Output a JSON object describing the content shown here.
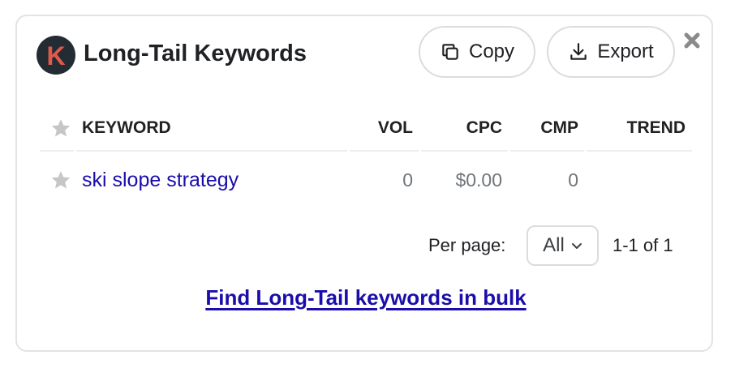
{
  "widget": {
    "title": "Long-Tail Keywords",
    "logo_letter": "K",
    "brand_color": "#e05a4c",
    "copy_label": "Copy",
    "export_label": "Export",
    "icons": {
      "copy": "copy-icon",
      "export": "download-icon",
      "close": "close-icon",
      "star": "star-icon",
      "chevron": "chevron-down-icon"
    }
  },
  "table": {
    "columns": [
      "KEYWORD",
      "VOL",
      "CPC",
      "CMP",
      "TREND"
    ],
    "rows": [
      {
        "keyword": "ski slope strategy",
        "vol": "0",
        "cpc": "$0.00",
        "cmp": "0",
        "trend": ""
      }
    ]
  },
  "pagination": {
    "per_page_label": "Per page:",
    "per_page_value": "All",
    "range_text": "1-1 of 1"
  },
  "footer": {
    "bulk_link": "Find Long-Tail keywords in bulk"
  },
  "colors": {
    "link": "#1a0dab",
    "muted": "#70757a",
    "border": "#dadce0"
  }
}
